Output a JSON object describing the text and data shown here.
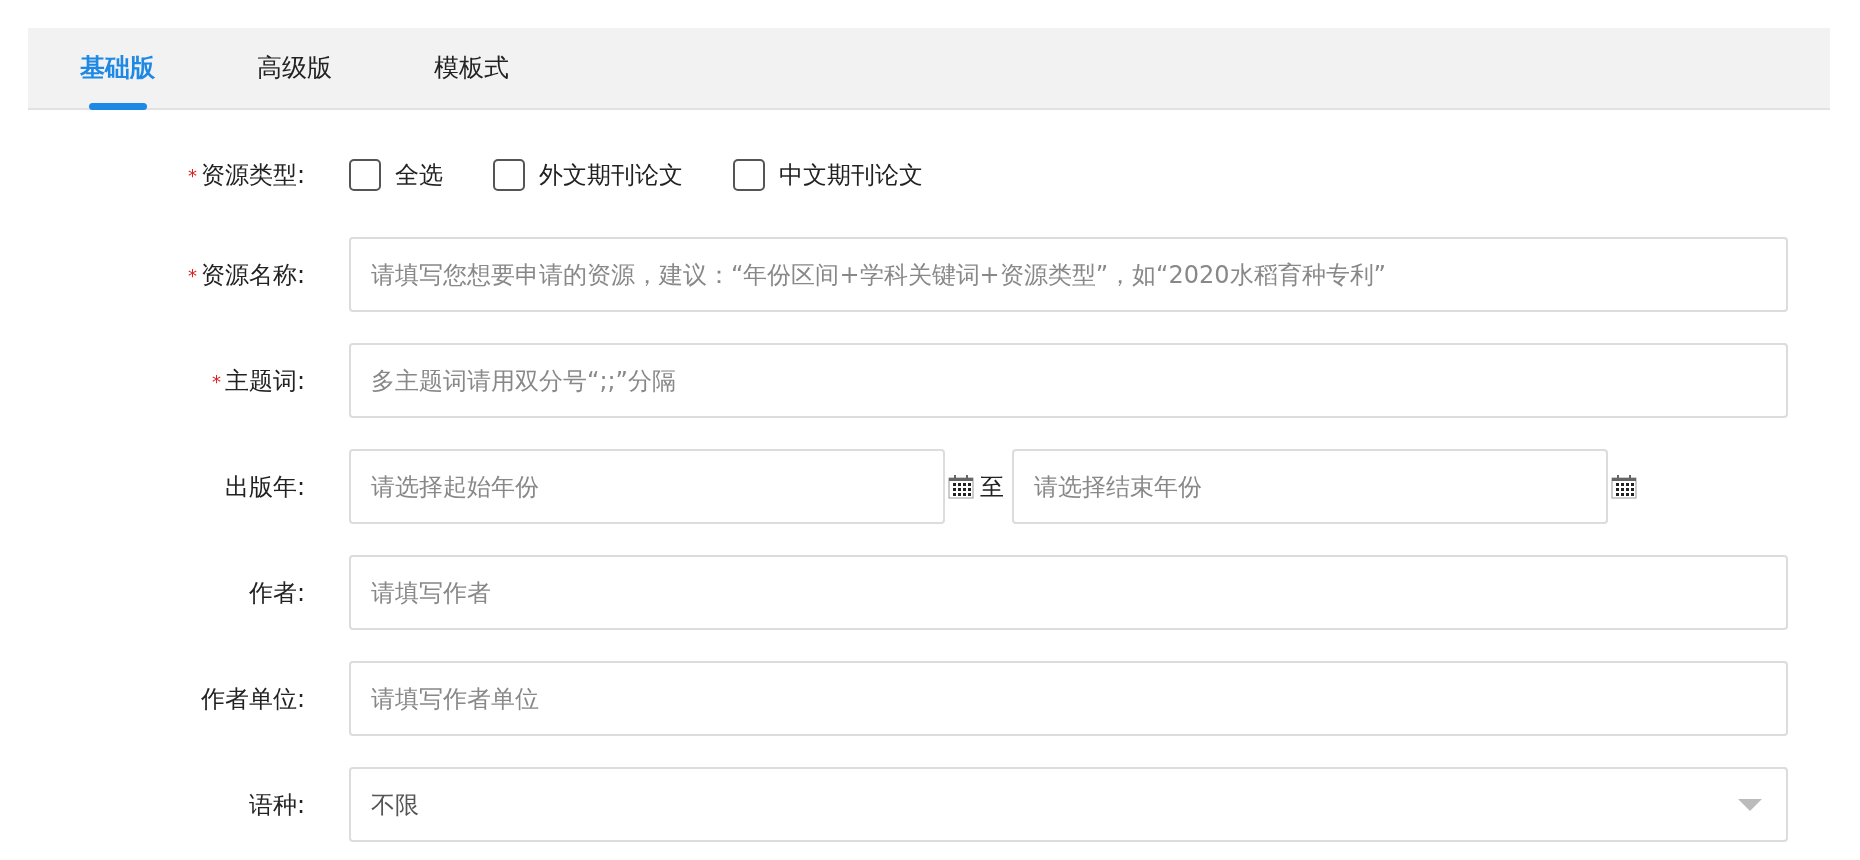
{
  "tabs": [
    {
      "label": "基础版",
      "selected": true
    },
    {
      "label": "高级版",
      "selected": false
    },
    {
      "label": "模板式",
      "selected": false
    }
  ],
  "form": {
    "fields": [
      {
        "kind": "checkboxes",
        "label": "资源类型:",
        "required_mark": "*",
        "options": [
          {
            "label": "全选",
            "checked": false
          },
          {
            "label": "外文期刊论文",
            "checked": false
          },
          {
            "label": "中文期刊论文",
            "checked": false
          }
        ]
      },
      {
        "kind": "text",
        "label": "资源名称:",
        "required_mark": "*",
        "placeholder": "请填写您想要申请的资源，建议：“年份区间+学科关键词+资源类型”，如“2020水稻育种专利”"
      },
      {
        "kind": "text",
        "label": "主题词:",
        "required_mark": "*",
        "placeholder": "多主题词请用双分号“;;”分隔"
      },
      {
        "kind": "year_range",
        "label": "出版年:",
        "start_placeholder": "请选择起始年份",
        "separator": "至",
        "end_placeholder": "请选择结束年份"
      },
      {
        "kind": "text",
        "label": "作者:",
        "placeholder": "请填写作者"
      },
      {
        "kind": "text",
        "label": "作者单位:",
        "placeholder": "请填写作者单位"
      },
      {
        "kind": "select",
        "label": "语种:",
        "value": "不限"
      }
    ]
  }
}
